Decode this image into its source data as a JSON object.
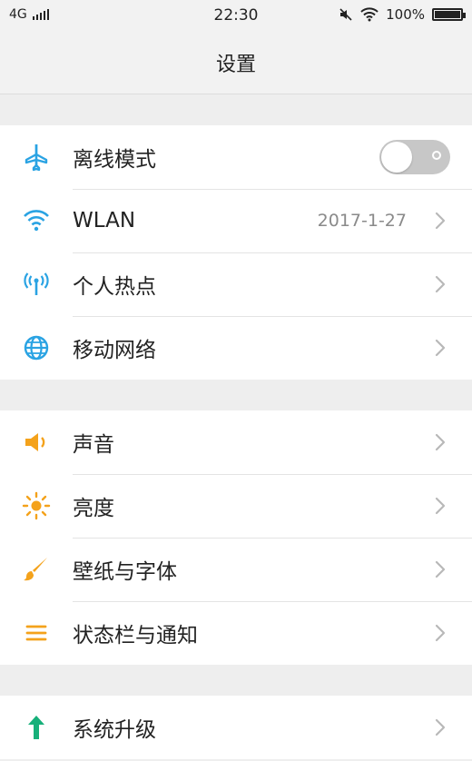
{
  "status_bar": {
    "network": "4G",
    "time": "22:30",
    "battery_percent_label": "100%",
    "battery_level": 1.0
  },
  "header": {
    "title": "设置"
  },
  "colors": {
    "blue_icon": "#2aa3e3",
    "orange_icon": "#f4a21b",
    "green_icon": "#17b07a",
    "toggle_off": "#c7c7c7"
  },
  "groups": [
    {
      "items": [
        {
          "label": "离线模式",
          "icon": "airplane-icon",
          "control": "toggle",
          "toggle_on": false
        },
        {
          "label": "WLAN",
          "icon": "wifi-icon",
          "value": "2017-1-27"
        },
        {
          "label": "个人热点",
          "icon": "hotspot-icon"
        },
        {
          "label": "移动网络",
          "icon": "globe-icon"
        }
      ]
    },
    {
      "items": [
        {
          "label": "声音",
          "icon": "speaker-icon"
        },
        {
          "label": "亮度",
          "icon": "sun-icon"
        },
        {
          "label": "壁纸与字体",
          "icon": "brush-icon"
        },
        {
          "label": "状态栏与通知",
          "icon": "menu-lines-icon"
        }
      ]
    },
    {
      "items": [
        {
          "label": "系统升级",
          "icon": "up-arrow-icon"
        }
      ]
    }
  ]
}
